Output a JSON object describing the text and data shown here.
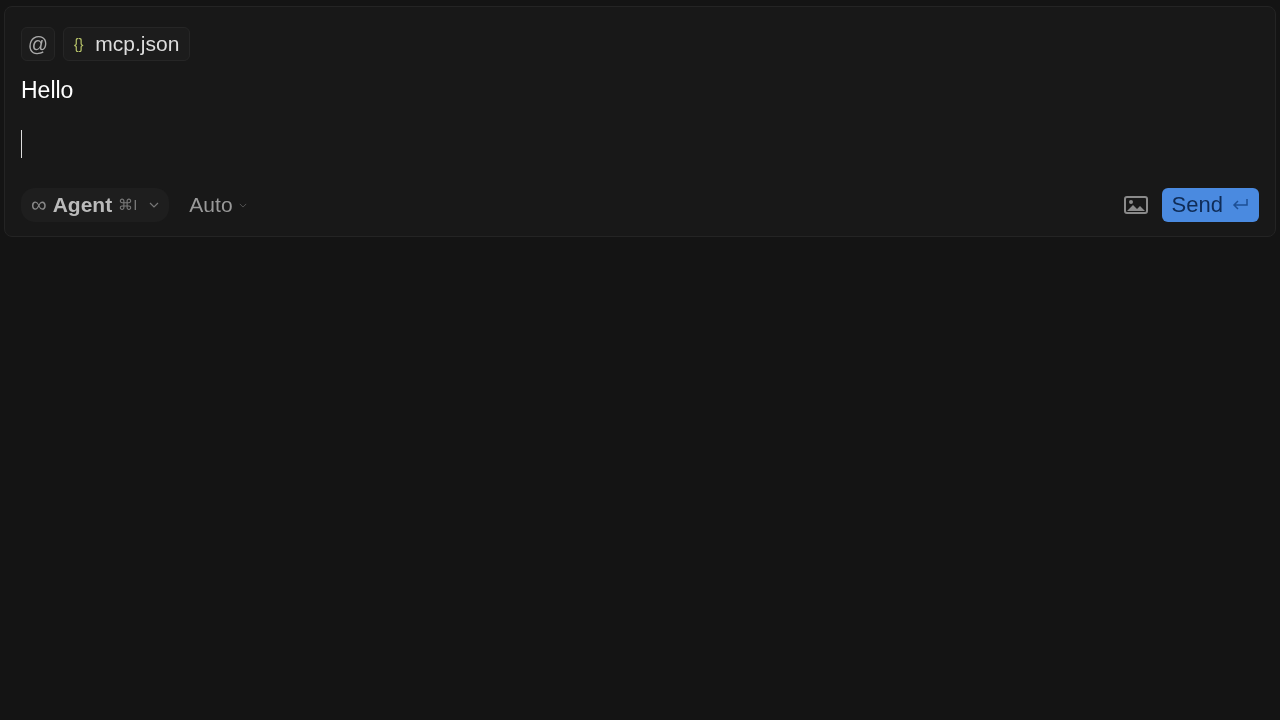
{
  "context": {
    "mention_button": "@",
    "file_chip": {
      "icon_text": "{}",
      "name": "mcp.json"
    }
  },
  "message": {
    "text": "Hello"
  },
  "footer": {
    "mode": {
      "icon_text": "∞",
      "label": "Agent",
      "shortcut": "⌘I"
    },
    "model": {
      "label": "Auto"
    },
    "send": {
      "label": "Send"
    }
  }
}
